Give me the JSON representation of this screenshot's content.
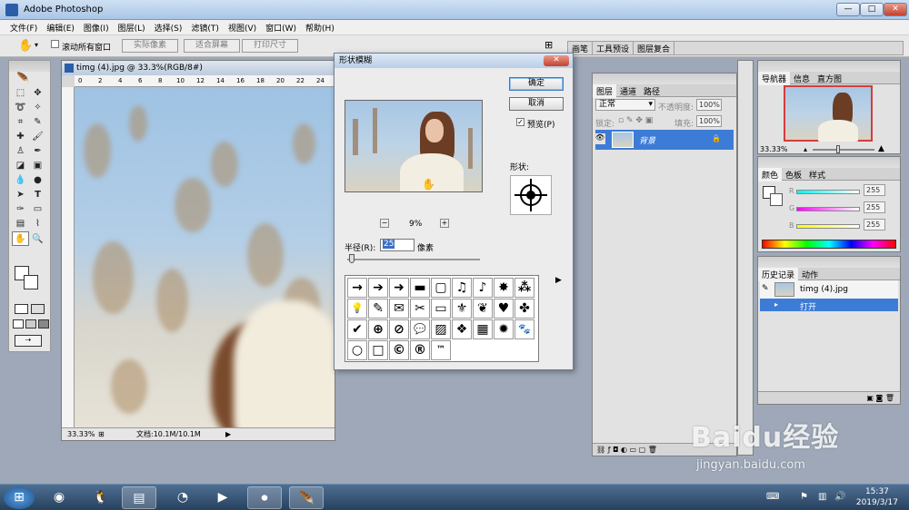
{
  "app": {
    "title": "Adobe Photoshop",
    "win_min": "—",
    "win_max": "□",
    "win_close": "✕"
  },
  "menu": [
    "文件(F)",
    "编辑(E)",
    "图像(I)",
    "图层(L)",
    "选择(S)",
    "滤镜(T)",
    "视图(V)",
    "窗口(W)",
    "帮助(H)"
  ],
  "options": {
    "scroll_all": "滚动所有窗口",
    "actual_pixels": "实际像素",
    "fit_screen": "适合屏幕",
    "print_size": "打印尺寸",
    "dock_tabs": [
      "画笔",
      "工具预设",
      "图层复合"
    ]
  },
  "document": {
    "title": "timg (4).jpg @ 33.3%(RGB/8#)",
    "ruler_ticks": [
      "0",
      "2",
      "4",
      "6",
      "8",
      "10",
      "12",
      "14",
      "16",
      "18",
      "20",
      "22",
      "24"
    ],
    "zoom": "33.33%",
    "doc_size": "文档:10.1M/10.1M"
  },
  "dialog": {
    "title": "形状模糊",
    "close": "✕",
    "ok": "确定",
    "cancel": "取消",
    "preview_label": "预览(P)",
    "preview_checked": true,
    "zoom_percent": "9%",
    "zoom_minus": "−",
    "zoom_plus": "+",
    "shape_label": "形状:",
    "radius_label": "半径(R):",
    "radius_value": "25",
    "radius_unit": "像素",
    "shapes": [
      "→",
      "➔",
      "➜",
      "▬",
      "▢",
      "♫",
      "♪",
      "✸",
      "⁂",
      "💡",
      "✎",
      "✉",
      "✂",
      "▭",
      "⚜",
      "❦",
      "♥",
      "✤",
      "✔",
      "⊕",
      "⊘",
      "💬",
      "▨",
      "❖",
      "▦",
      "✹",
      "🐾",
      "○",
      "□",
      "©",
      "®",
      "™"
    ]
  },
  "layers": {
    "tabs": [
      "图层",
      "通道",
      "路径"
    ],
    "blend_mode": "正常",
    "opacity_label": "不透明度:",
    "opacity_value": "100%",
    "lock_label": "锁定:",
    "fill_label": "填充:",
    "fill_value": "100%",
    "layer_name": "背景"
  },
  "navigator": {
    "tabs": [
      "导航器",
      "信息",
      "直方图"
    ],
    "zoom": "33.33%"
  },
  "color": {
    "tabs": [
      "颜色",
      "色板",
      "样式"
    ],
    "channels": [
      {
        "label": "R",
        "value": "255"
      },
      {
        "label": "G",
        "value": "255"
      },
      {
        "label": "B",
        "value": "255"
      }
    ]
  },
  "history": {
    "tabs": [
      "历史记录",
      "动作"
    ],
    "snapshot": "timg (4).jpg",
    "step": "打开"
  },
  "taskbar": {
    "time": "15:37",
    "date": "2019/3/17"
  },
  "watermark": {
    "brand": "Baidu经验",
    "url": "jingyan.baidu.com"
  }
}
